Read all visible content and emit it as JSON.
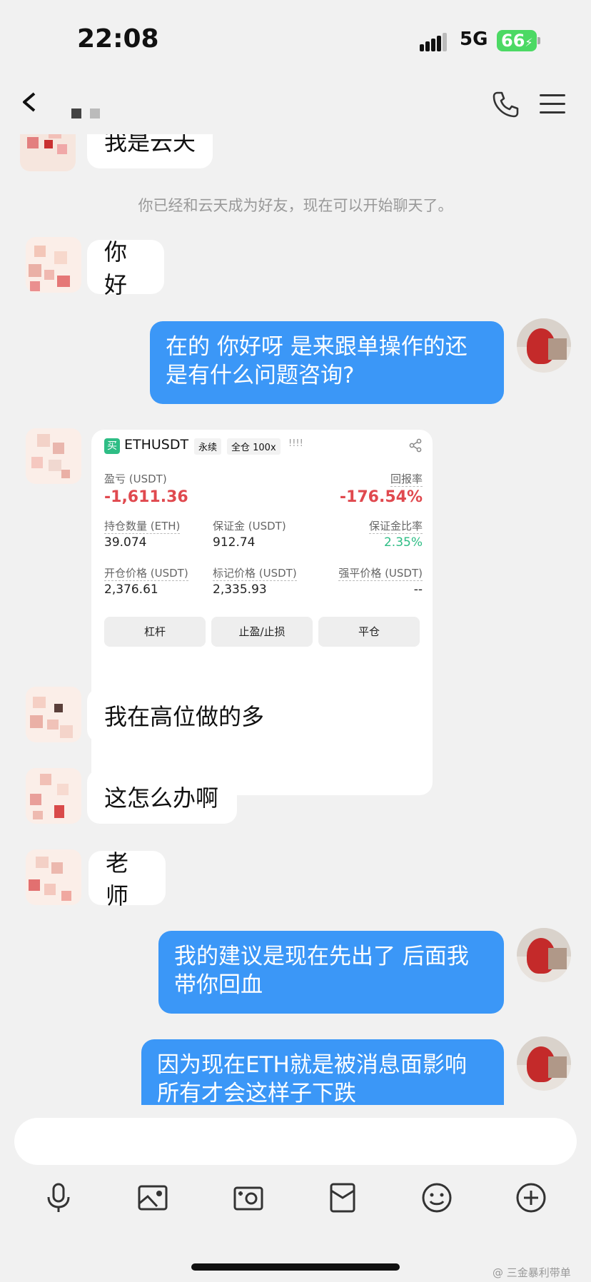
{
  "status_bar": {
    "time": "22:08",
    "network": "5G",
    "battery": "66"
  },
  "chat": {
    "messages": [
      {
        "from": "them",
        "text": "我是云天"
      },
      {
        "from": "system",
        "text": "你已经和云天成为好友，现在可以开始聊天了。"
      },
      {
        "from": "them",
        "text": "你好"
      },
      {
        "from": "me",
        "text": "在的 你好呀 是来跟单操作的还是有什么问题咨询?"
      },
      {
        "from": "them",
        "text": "我在高位做的多"
      },
      {
        "from": "them",
        "text": "这怎么办啊"
      },
      {
        "from": "them",
        "text": "老师"
      },
      {
        "from": "me",
        "text": "我的建议是现在先出了 后面我带你回血"
      },
      {
        "from": "me",
        "text": "因为现在ETH就是被消息面影响所有才会这样子下跌"
      }
    ],
    "position_card": {
      "side_badge": "买",
      "symbol": "ETHUSDT",
      "contract_type": "永续",
      "margin_mode": "全仓 100x",
      "marks": "!!!!",
      "pnl_label": "盈亏 (USDT)",
      "pnl_value": "-1,611.36",
      "roe_label": "回报率",
      "roe_value": "-176.54%",
      "size_label": "持仓数量 (ETH)",
      "size_value": "39.074",
      "margin_label": "保证金 (USDT)",
      "margin_value": "912.74",
      "margin_ratio_label": "保证金比率",
      "margin_ratio_value": "2.35%",
      "entry_label": "开仓价格 (USDT)",
      "entry_value": "2,376.61",
      "mark_label": "标记价格 (USDT)",
      "mark_value": "2,335.93",
      "liq_label": "强平价格 (USDT)",
      "liq_value": "--",
      "buttons": [
        "杠杆",
        "止盈/止损",
        "平仓"
      ]
    }
  },
  "toolbar": {
    "icons": [
      "microphone-icon",
      "image-icon",
      "camera-icon",
      "red-packet-icon",
      "emoji-icon",
      "add-icon"
    ]
  },
  "watermark": "@ 三金暴利带单",
  "colors": {
    "bubble_out": "#3b97f7",
    "loss": "#e0494f",
    "gain": "#2ebd85"
  }
}
